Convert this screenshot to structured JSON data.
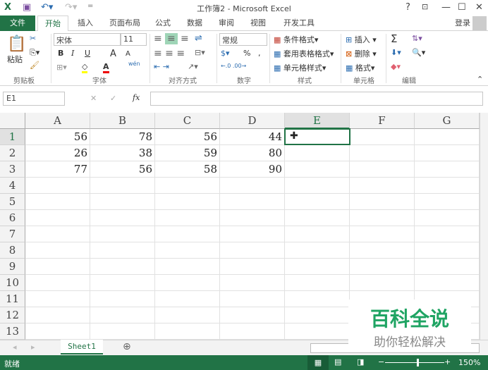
{
  "window": {
    "title": "工作簿2 - Microsoft Excel",
    "help": "?",
    "signin": "登录"
  },
  "tabs": [
    "文件",
    "开始",
    "插入",
    "页面布局",
    "公式",
    "数据",
    "审阅",
    "视图",
    "开发工具"
  ],
  "ribbon": {
    "clipboard": {
      "paste": "粘贴",
      "label": "剪贴板"
    },
    "font": {
      "name": "宋体",
      "size": "11",
      "bold": "B",
      "italic": "I",
      "underline": "U",
      "grow": "A",
      "shrink": "A",
      "label": "字体",
      "wen": "wén"
    },
    "alignment": {
      "label": "对齐方式"
    },
    "number": {
      "format": "常规",
      "percent": "%",
      "comma": ",",
      "label": "数字"
    },
    "styles": {
      "conditional": "条件格式",
      "table": "套用表格格式",
      "cell": "单元格样式",
      "label": "样式"
    },
    "cells": {
      "insert": "插入",
      "delete": "删除",
      "format": "格式",
      "label": "单元格"
    },
    "editing": {
      "label": "编辑",
      "sum": "Σ"
    }
  },
  "formula_bar": {
    "name_box": "E1",
    "fx": "fx",
    "value": ""
  },
  "columns": [
    "A",
    "B",
    "C",
    "D",
    "E",
    "F",
    "G"
  ],
  "rows": [
    "1",
    "2",
    "3",
    "4",
    "5",
    "6",
    "7",
    "8",
    "9",
    "10",
    "11",
    "12",
    "13"
  ],
  "cells": [
    [
      "56",
      "78",
      "56",
      "44"
    ],
    [
      "26",
      "38",
      "59",
      "80"
    ],
    [
      "77",
      "56",
      "58",
      "90"
    ]
  ],
  "sheets": [
    "Sheet1"
  ],
  "status": {
    "ready": "就绪",
    "zoom": "150%"
  },
  "watermark": {
    "title": "百科全说",
    "subtitle": "助你轻松解决"
  },
  "colors": {
    "accent": "#217346"
  }
}
